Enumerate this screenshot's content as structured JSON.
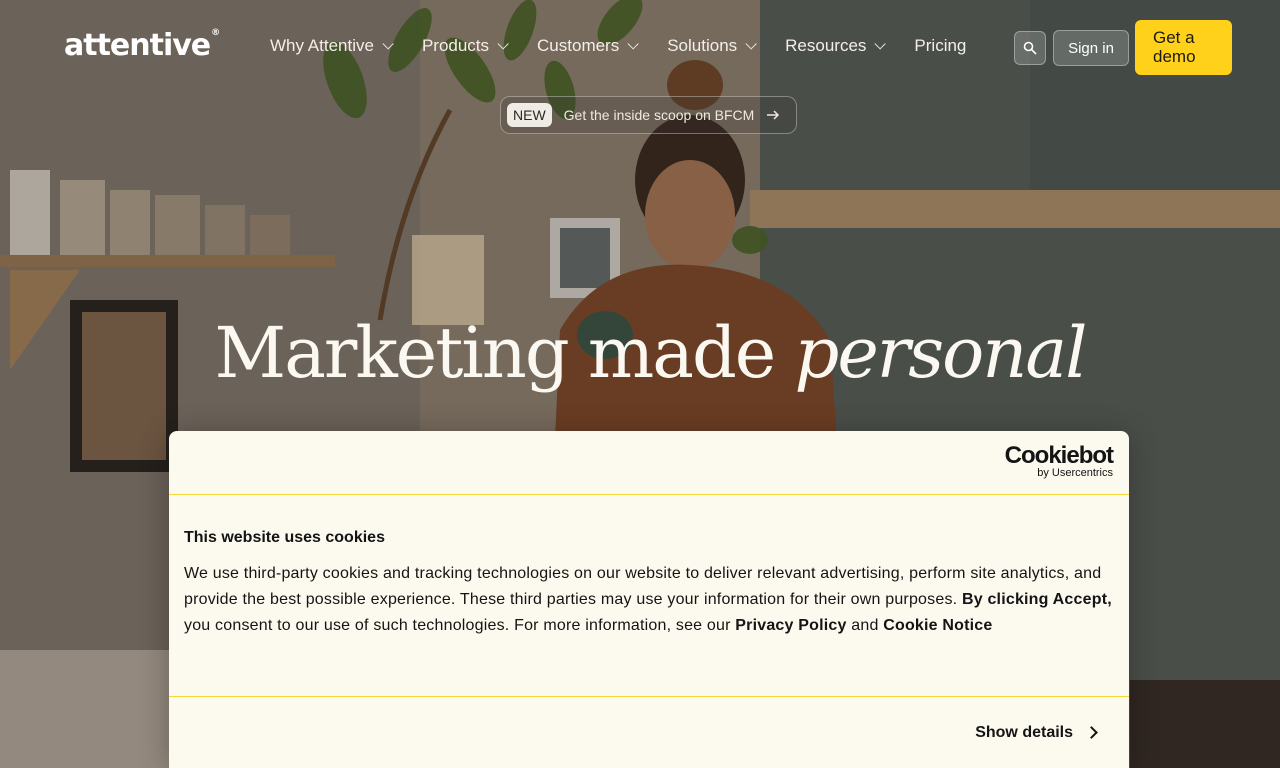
{
  "nav": {
    "logo": "attentive",
    "logo_mark": "®",
    "menu": [
      {
        "label": "Why Attentive",
        "has_dropdown": true
      },
      {
        "label": "Products",
        "has_dropdown": true
      },
      {
        "label": "Customers",
        "has_dropdown": true
      },
      {
        "label": "Solutions",
        "has_dropdown": true
      },
      {
        "label": "Resources",
        "has_dropdown": true
      },
      {
        "label": "Pricing",
        "has_dropdown": false
      }
    ],
    "search_icon": "search-icon",
    "sign_in_label": "Sign in",
    "demo_label": "Get a demo",
    "accent_color": "#ffd11a"
  },
  "announcement": {
    "badge": "NEW",
    "text": "Get the inside scoop on BFCM",
    "icon": "arrow-right-icon"
  },
  "hero": {
    "headline_main": "Marketing made",
    "headline_italic": "personal"
  },
  "cookie_banner": {
    "brand": "Cookiebot",
    "brand_sub": "by Usercentrics",
    "title": "This website uses cookies",
    "text_1": "We use third-party cookies and tracking technologies on our website to deliver relevant advertising, perform site analytics, and provide the best possible experience. These third parties may use your information for their own purposes. ",
    "text_bold_1": "By clicking Accept,",
    "text_2": " you consent to our use of such technologies. For more information, see our ",
    "text_bold_privacy": "Privacy Policy",
    "text_3": " and ",
    "text_bold_cookie": "Cookie Notice",
    "show_details_label": "Show details",
    "divider_color": "#f5d73a"
  }
}
